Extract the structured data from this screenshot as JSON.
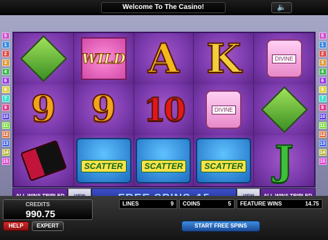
{
  "title": "Welcome To The Casino!",
  "sound_icon": "speaker-icon",
  "paylines_left": [
    "5",
    "1",
    "2",
    "3",
    "4",
    "6",
    "8",
    "7",
    "9",
    "10",
    "11",
    "12",
    "13",
    "14",
    "15"
  ],
  "paylines_right": [
    "5",
    "1",
    "2",
    "3",
    "4",
    "6",
    "8",
    "7",
    "9",
    "10",
    "11",
    "12",
    "13",
    "14",
    "15"
  ],
  "payline_colors": [
    "#d14dd1",
    "#3b8ae0",
    "#e04b4b",
    "#e09a3b",
    "#3bb84f",
    "#9b3be0",
    "#e0d13b",
    "#3be0cf",
    "#e03b8a",
    "#5a3be0",
    "#7ce03b",
    "#e0703b",
    "#3b62e0",
    "#b8b83b",
    "#e03bcf"
  ],
  "reels": [
    [
      "cocktail",
      "nine",
      "lipstick"
    ],
    [
      "wild",
      "nine",
      "scatter"
    ],
    [
      "ace",
      "ten",
      "scatter"
    ],
    [
      "king",
      "perfume",
      "scatter"
    ],
    [
      "perfume",
      "cocktail",
      "jack"
    ]
  ],
  "symbols": {
    "wild": "WILD",
    "nine": "9",
    "ten": "10",
    "ace": "A",
    "king": "K",
    "jack": "J",
    "scatter": "SCATTER",
    "perfume": "DIVINE"
  },
  "info": {
    "left_tripled": "ALL WINS TRIPLED",
    "left_payout": "VIEW PAYOUT",
    "banner_label": "FREE SPINS",
    "banner_count": "15",
    "right_payout": "VIEW PAYOUT",
    "right_tripled": "ALL WINS TRIPLED"
  },
  "footer": {
    "credits_label": "CREDITS",
    "credits_value": "990.75",
    "help_label": "HELP",
    "expert_label": "EXPERT",
    "lines_label": "LINES",
    "lines_value": "9",
    "coins_label": "COINS",
    "coins_value": "5",
    "feature_label": "FEATURE WINS",
    "feature_value": "14.75",
    "start_label": "START FREE SPINS"
  }
}
